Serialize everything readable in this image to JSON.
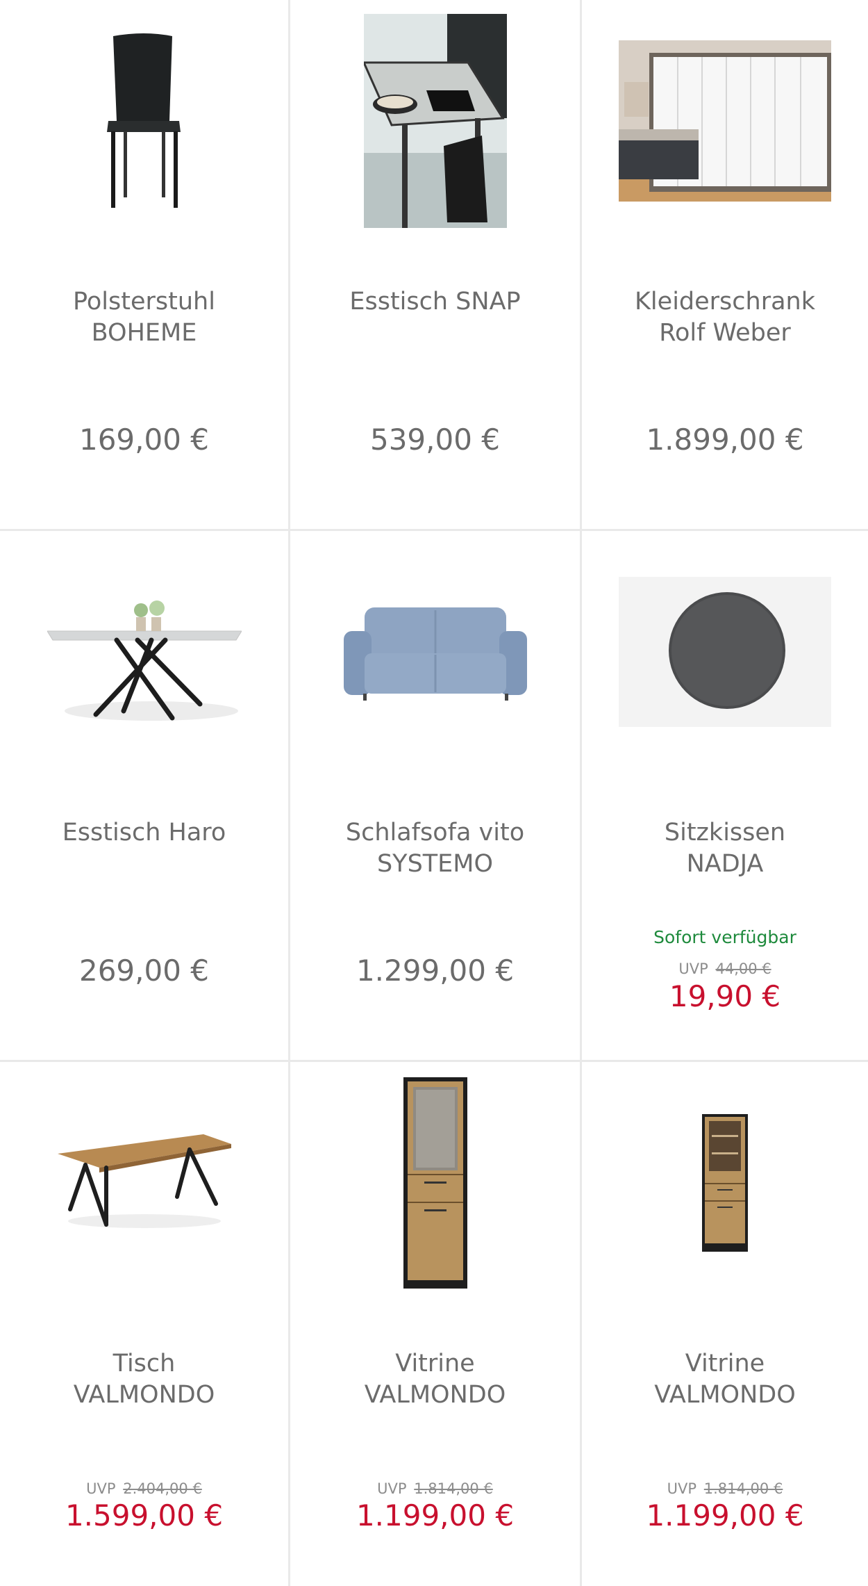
{
  "products": [
    {
      "name": "Polsterstuhl\nBOHEME",
      "price": "169,00 €",
      "image": "black-leather-chair"
    },
    {
      "name": "Esstisch SNAP",
      "price": "539,00 €",
      "image": "dining-table-photo"
    },
    {
      "name": "Kleiderschrank\nRolf Weber",
      "price": "1.899,00 €",
      "image": "white-wardrobe"
    },
    {
      "name": "Esstisch Haro",
      "price": "269,00 €",
      "image": "table-cross-legs"
    },
    {
      "name": "Schlafsofa vito\nSYSTEMO",
      "price": "1.299,00 €",
      "image": "blue-sofa"
    },
    {
      "name": "Sitzkissen\nNADJA",
      "availability": "Sofort verfügbar",
      "uvp_label": "UVP",
      "uvp_price": "44,00 €",
      "price": "19,90 €",
      "image": "grey-seat-cushion"
    },
    {
      "name": "Tisch\nVALMONDO",
      "uvp_label": "UVP",
      "uvp_price": "2.404,00 €",
      "price": "1.599,00 €",
      "image": "oak-table"
    },
    {
      "name": "Vitrine\nVALMONDO",
      "uvp_label": "UVP",
      "uvp_price": "1.814,00 €",
      "price": "1.199,00 €",
      "image": "tall-vitrine"
    },
    {
      "name": "Vitrine\nVALMONDO",
      "uvp_label": "UVP",
      "uvp_price": "1.814,00 €",
      "price": "1.199,00 €",
      "image": "small-vitrine"
    }
  ],
  "colors": {
    "text": "#6b6b6b",
    "sale": "#c8102e",
    "available": "#1e8a3c",
    "divider": "#e9e9e9"
  }
}
